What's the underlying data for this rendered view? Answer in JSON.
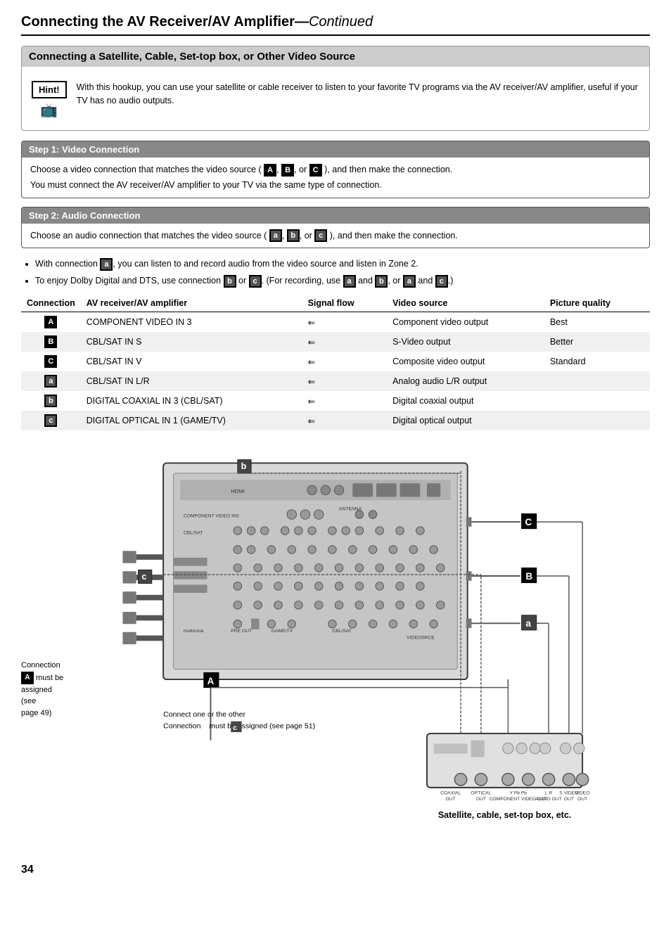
{
  "page": {
    "title": "Connecting the AV Receiver/AV Amplifier",
    "title_continued": "Continued",
    "page_number": "34"
  },
  "section": {
    "header": "Connecting a Satellite, Cable, Set-top box, or Other Video Source",
    "hint_label": "Hint!",
    "hint_text": "With this hookup, you can use your satellite or cable receiver to listen to your favorite TV programs via the AV receiver/AV amplifier, useful if your TV has no audio outputs."
  },
  "step1": {
    "header": "Step 1: Video Connection",
    "line1": "Choose a video connection that matches the video source (A, B, or C), and then make the connection.",
    "line2": "You must connect the AV receiver/AV amplifier to your TV via the same type of connection."
  },
  "step2": {
    "header": "Step 2: Audio Connection",
    "line1": "Choose an audio connection that matches the video source (a, b, or c), and then make the connection."
  },
  "bullets": [
    "With connection a, you can listen to and record audio from the video source and listen in Zone 2.",
    "To enjoy Dolby Digital and DTS, use connection b or c. (For recording, use a and b, or a and c.)"
  ],
  "table": {
    "headers": [
      "Connection",
      "AV receiver/AV amplifier",
      "Signal flow",
      "Video source",
      "Picture quality"
    ],
    "rows": [
      {
        "conn": "A",
        "conn_type": "upper",
        "av": "COMPONENT VIDEO IN 3",
        "flow": "⇐",
        "source": "Component video output",
        "quality": "Best"
      },
      {
        "conn": "B",
        "conn_type": "upper",
        "av": "CBL/SAT IN S",
        "flow": "⇐",
        "source": "S-Video output",
        "quality": "Better"
      },
      {
        "conn": "C",
        "conn_type": "upper",
        "av": "CBL/SAT IN V",
        "flow": "⇐",
        "source": "Composite video output",
        "quality": "Standard"
      },
      {
        "conn": "a",
        "conn_type": "lower",
        "av": "CBL/SAT IN L/R",
        "flow": "⇐",
        "source": "Analog audio L/R output",
        "quality": ""
      },
      {
        "conn": "b",
        "conn_type": "lower",
        "av": "DIGITAL COAXIAL IN 3 (CBL/SAT)",
        "flow": "⇐",
        "source": "Digital coaxial output",
        "quality": ""
      },
      {
        "conn": "c",
        "conn_type": "lower",
        "av": "DIGITAL OPTICAL IN 1 (GAME/TV)",
        "flow": "⇐",
        "source": "Digital optical output",
        "quality": ""
      }
    ]
  },
  "diagram": {
    "connection_note": "Connection A must be assigned (see page 49)",
    "connect_note": "Connect one or the other",
    "connection_c_note": "Connection c must be assigned (see page 51)",
    "satellite_caption": "Satellite, cable, set-top box, etc.",
    "bottom_labels": [
      "COAXIAL OUT",
      "OPTICAL OUT",
      "Y    Pb    Pb\nCOMPONENT VIDEO OUT",
      "L        R\nAUDIO OUT",
      "S VIDEO OUT",
      "VIDEO OUT"
    ]
  }
}
